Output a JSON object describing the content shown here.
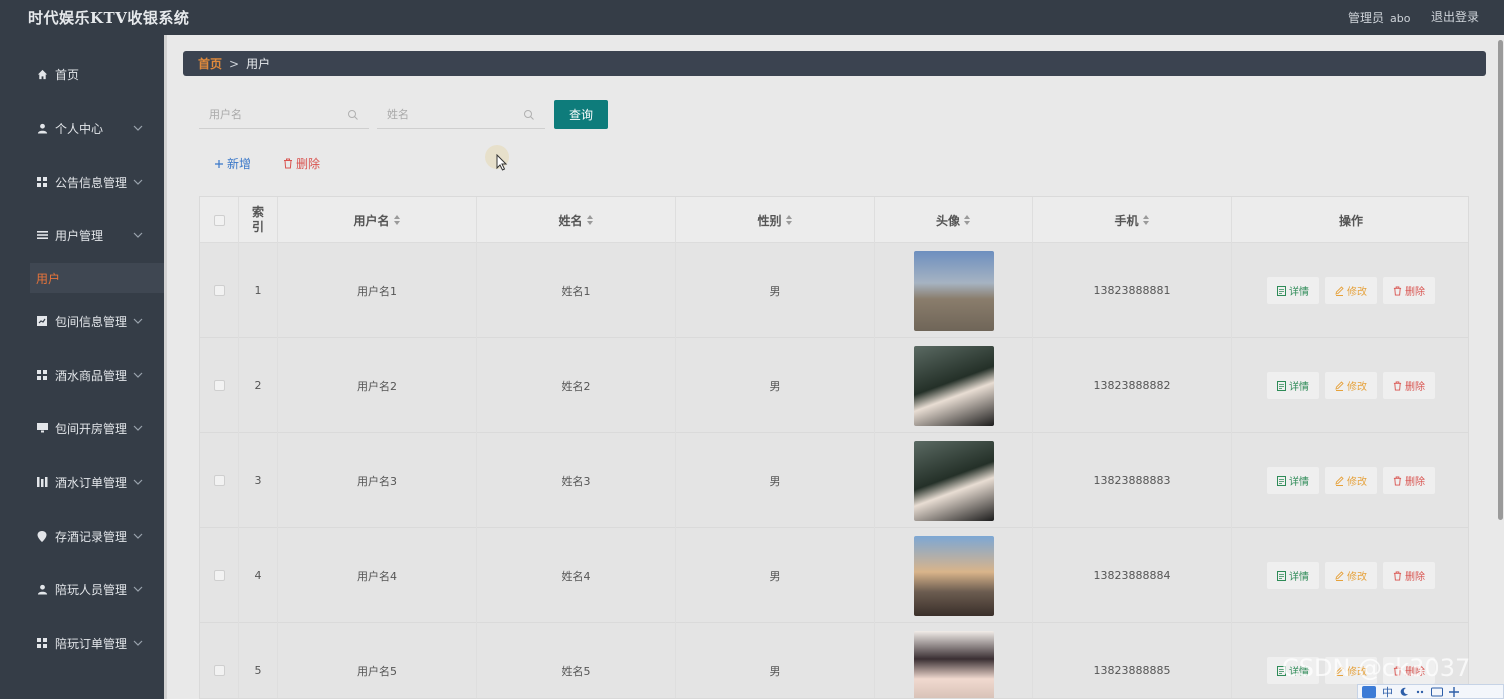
{
  "app": {
    "title": "时代娱乐KTV收银系统",
    "user_role": "管理员",
    "username": "abo",
    "logout_label": "退出登录"
  },
  "sidebar": {
    "items": [
      {
        "label": "首页",
        "icon": "home-icon"
      },
      {
        "label": "个人中心",
        "icon": "user-icon"
      },
      {
        "label": "公告信息管理",
        "icon": "grid-icon"
      },
      {
        "label": "用户管理",
        "icon": "list-icon"
      },
      {
        "label": "包间信息管理",
        "icon": "chart-icon"
      },
      {
        "label": "酒水商品管理",
        "icon": "grid-icon"
      },
      {
        "label": "包间开房管理",
        "icon": "monitor-icon"
      },
      {
        "label": "酒水订单管理",
        "icon": "bars-icon"
      },
      {
        "label": "存酒记录管理",
        "icon": "pin-icon"
      },
      {
        "label": "陪玩人员管理",
        "icon": "user-icon"
      },
      {
        "label": "陪玩订单管理",
        "icon": "grid-icon"
      }
    ],
    "active_sub": "用户"
  },
  "breadcrumb": {
    "home": "首页",
    "separator": ">",
    "current": "用户"
  },
  "search": {
    "username_placeholder": "用户名",
    "name_placeholder": "姓名",
    "query_label": "查询"
  },
  "actions": {
    "add_label": "新增",
    "delete_label": "删除"
  },
  "table": {
    "headers": {
      "index": "索引",
      "username": "用户名",
      "name": "姓名",
      "gender": "性别",
      "avatar": "头像",
      "phone": "手机",
      "ops": "操作"
    },
    "row_actions": {
      "detail": "详情",
      "edit": "修改",
      "delete": "删除"
    },
    "rows": [
      {
        "index": "1",
        "username": "用户名1",
        "name": "姓名1",
        "gender": "男",
        "phone": "13823888881"
      },
      {
        "index": "2",
        "username": "用户名2",
        "name": "姓名2",
        "gender": "男",
        "phone": "13823888882"
      },
      {
        "index": "3",
        "username": "用户名3",
        "name": "姓名3",
        "gender": "男",
        "phone": "13823888883"
      },
      {
        "index": "4",
        "username": "用户名4",
        "name": "姓名4",
        "gender": "男",
        "phone": "13823888884"
      },
      {
        "index": "5",
        "username": "用户名5",
        "name": "姓名5",
        "gender": "男",
        "phone": "13823888885"
      }
    ]
  },
  "overlay": {
    "watermark": "CSDN @ck3037",
    "ime_label": "中"
  },
  "colors": {
    "header_bg": "#353d47",
    "accent_teal": "#0e7c7b",
    "active_orange": "#e8743a",
    "detail_green": "#2e8b57",
    "edit_orange": "#e6a23c",
    "delete_red": "#d9534f"
  }
}
